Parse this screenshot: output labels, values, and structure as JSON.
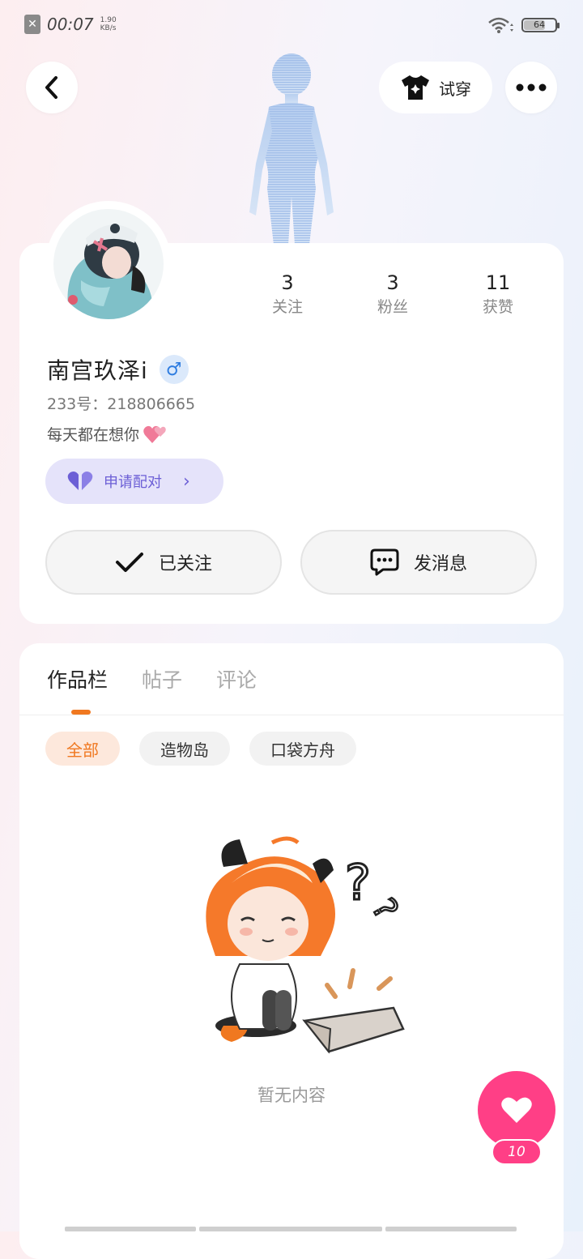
{
  "status_bar": {
    "time": "00:07",
    "net_speed_value": "1.90",
    "net_speed_unit": "KB/s",
    "battery": "64"
  },
  "header": {
    "tryon_label": "试穿"
  },
  "profile": {
    "username": "南宫玖泽i",
    "gender_symbol": "♂",
    "user_id": "233号：218806665",
    "bio": "每天都在想你"
  },
  "stats": [
    {
      "value": "3",
      "label": "关注"
    },
    {
      "value": "3",
      "label": "粉丝"
    },
    {
      "value": "11",
      "label": "获赞"
    }
  ],
  "pair_button": {
    "label": "申请配对"
  },
  "actions": {
    "follow_label": "已关注",
    "message_label": "发消息"
  },
  "tabs": [
    {
      "label": "作品栏"
    },
    {
      "label": "帖子"
    },
    {
      "label": "评论"
    }
  ],
  "filter_chips": [
    {
      "label": "全部"
    },
    {
      "label": "造物岛"
    },
    {
      "label": "口袋方舟"
    }
  ],
  "empty_state": {
    "text": "暂无内容"
  },
  "like": {
    "count": "10"
  },
  "colors": {
    "accent_orange": "#f07820",
    "like_pink": "#ff3f86",
    "pair_purple": "#6c5fd6",
    "male_blue": "#2f7de0"
  }
}
